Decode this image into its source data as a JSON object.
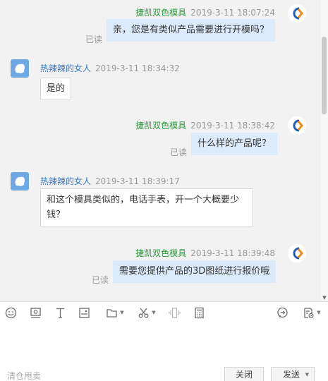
{
  "messages": [
    {
      "direction": "out",
      "sender": "捷凯双色模具",
      "time": "2019-3-11 18:07:24",
      "text": "亲，您是有类似产品需要进行开模吗？",
      "status": "已读"
    },
    {
      "direction": "in",
      "sender": "热辣辣的女人",
      "time": "2019-3-11 18:34:32",
      "text": "是的"
    },
    {
      "direction": "out",
      "sender": "捷凯双色模具",
      "time": "2019-3-11 18:38:42",
      "text": "什么样的产品呢？",
      "status": "已读"
    },
    {
      "direction": "in",
      "sender": "热辣辣的女人",
      "time": "2019-3-11 18:39:17",
      "text": "和这个模具类似的，电话手表，开一个大概要少钱？"
    },
    {
      "direction": "out",
      "sender": "捷凯双色模具",
      "time": "2019-3-11 18:39:48",
      "text": "需要您提供产品的3D图纸进行报价哦",
      "status": "已读"
    }
  ],
  "toolbar": {
    "icons": [
      "emoji-icon",
      "screenshot-icon",
      "font-icon",
      "image-icon",
      "folder-icon",
      "scissors-icon",
      "vibrate-icon",
      "calculator-icon",
      "quick-reply-icon",
      "history-icon"
    ]
  },
  "composer": {
    "tip": "清仓甩卖",
    "close_label": "关闭",
    "send_label": "发送"
  },
  "colors": {
    "outgoing_name": "#2e9a3a",
    "incoming_name": "#3a76c7",
    "outgoing_bubble": "#dcebfb",
    "incoming_bubble": "#ffffff"
  }
}
